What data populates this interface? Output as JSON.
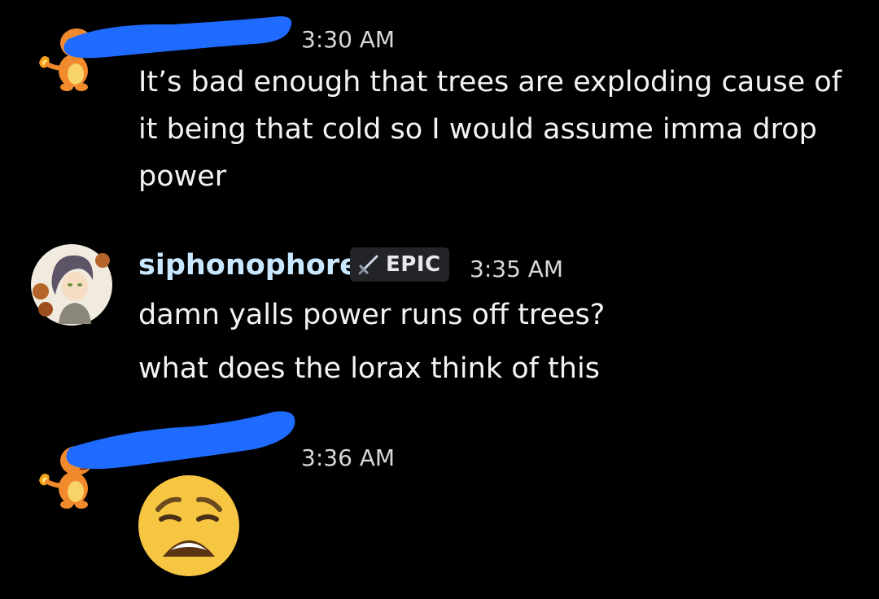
{
  "messages": [
    {
      "timestamp": "3:30 AM",
      "lines": [
        "It’s bad enough that trees are exploding cause of",
        "it being that cold so I would assume imma drop",
        "power"
      ]
    },
    {
      "username": "siphonophore",
      "badge": "EPIC",
      "timestamp": "3:35 AM",
      "lines": [
        "damn yalls power runs off trees?",
        "what does the lorax think of this"
      ]
    },
    {
      "timestamp": "3:36 AM",
      "emoji": "weary-face"
    }
  ],
  "colors": {
    "background": "#000000",
    "text": "#f2f3f5",
    "timestamp": "#d7d8dc",
    "username": "#c9e8ff",
    "redaction": "#1f6bff",
    "badge_bg": "#232428"
  },
  "icons": [
    "charmander-avatar",
    "character-avatar",
    "sword-icon",
    "weary-face-emoji"
  ]
}
